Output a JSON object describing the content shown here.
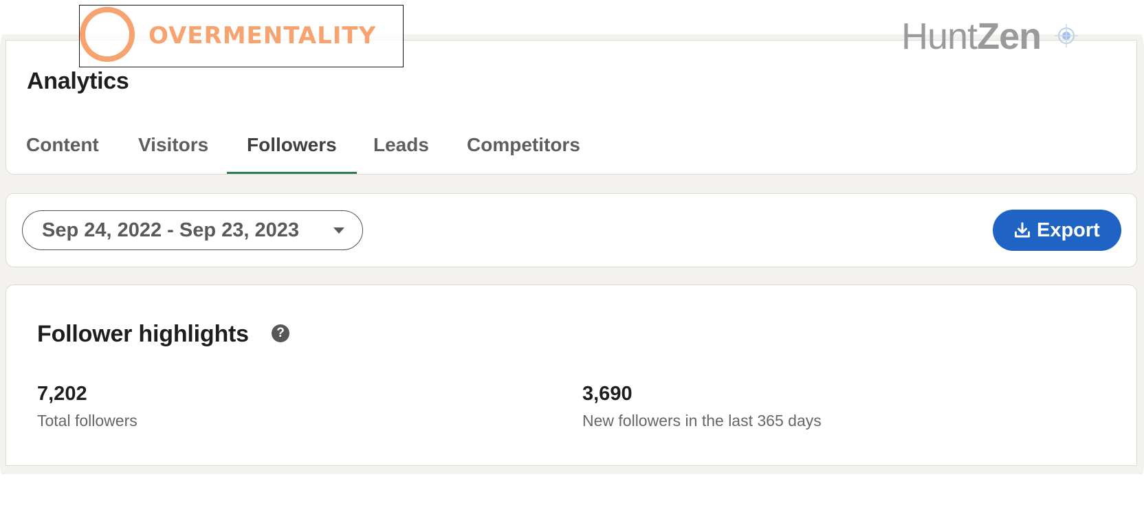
{
  "header": {
    "title": "Analytics",
    "tabs": [
      {
        "label": "Content"
      },
      {
        "label": "Visitors"
      },
      {
        "label": "Followers"
      },
      {
        "label": "Leads"
      },
      {
        "label": "Competitors"
      }
    ],
    "active_tab": "Followers"
  },
  "filters": {
    "date_range": "Sep 24, 2022 - Sep 23, 2023",
    "export_label": "Export",
    "export_icon": "download-icon",
    "date_caret_icon": "caret-down-icon"
  },
  "highlights": {
    "title": "Follower highlights",
    "help_icon": "question-icon",
    "metrics": [
      {
        "value": "7,202",
        "label": "Total followers"
      },
      {
        "value": "3,690",
        "label": "New followers in the last 365 days"
      }
    ]
  },
  "watermarks": {
    "left_brand": "OVERMENTALITY",
    "right_brand_part1": "Hunt",
    "right_brand_part2": "Zen"
  },
  "colors": {
    "accent_tab_underline": "#2e7d4f",
    "export_button": "#1f64c5",
    "page_background": "#f3f2ef",
    "brand_orange": "#f6a36f"
  }
}
